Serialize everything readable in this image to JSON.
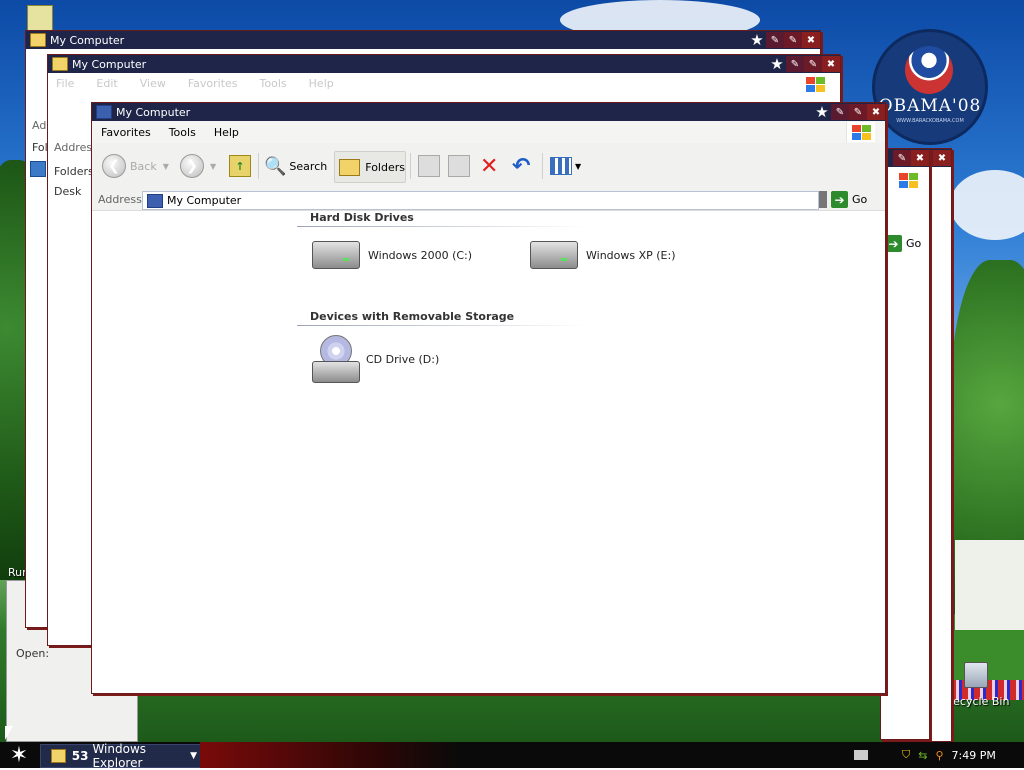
{
  "desktop": {
    "recycle_bin_label": "Recycle Bin",
    "obama_text": "OBAMA'08",
    "obama_subtext": "WWW.BARACKOBAMA.COM",
    "run_label": "Run",
    "open_label": "Open:"
  },
  "windows_back": [
    {
      "title": "My Computer",
      "address_label": "Address",
      "folders_label": "Folders",
      "desktop_label": "Desk"
    },
    {
      "title": "My Computer",
      "address_label": "Address",
      "folders_label": "Folders",
      "menu": [
        "File",
        "Edit",
        "View",
        "Favorites",
        "Tools",
        "Help"
      ]
    }
  ],
  "window": {
    "title": "My Computer",
    "menu": [
      "Favorites",
      "Tools",
      "Help"
    ],
    "toolbar": {
      "back_label": "Back",
      "search_label": "Search",
      "folders_label": "Folders"
    },
    "address": {
      "label": "Address",
      "value": "My Computer",
      "go_label": "Go"
    },
    "groups": [
      {
        "title": "Hard Disk Drives",
        "items": [
          {
            "label": "Windows 2000 (C:)",
            "icon": "hard-drive-icon"
          },
          {
            "label": "Windows XP (E:)",
            "icon": "hard-drive-icon"
          }
        ]
      },
      {
        "title": "Devices with Removable Storage",
        "items": [
          {
            "label": "CD Drive (D:)",
            "icon": "cd-drive-icon"
          }
        ]
      }
    ]
  },
  "right_windows": {
    "go_label": "Go"
  },
  "taskbar": {
    "task_count": "53",
    "task_label": "Windows Explorer",
    "clock": "7:49 PM"
  }
}
